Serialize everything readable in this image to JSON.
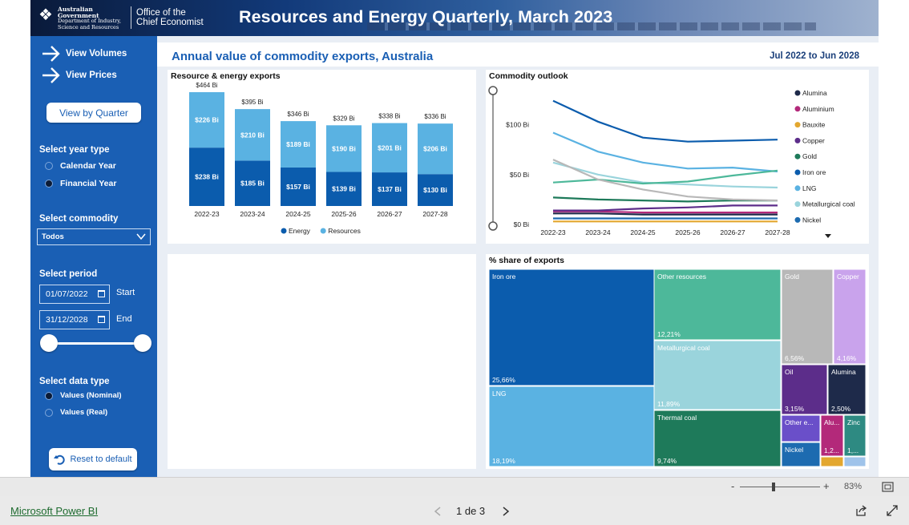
{
  "header": {
    "gov_line1": "Australian Government",
    "gov_line2": "Department of Industry,",
    "gov_line3": "Science and Resources",
    "office_line1": "Office of the",
    "office_line2": "Chief Economist",
    "title": "Resources and Energy Quarterly, March 2023"
  },
  "sidebar": {
    "nav": [
      {
        "label": "View Volumes",
        "icon": "arrow-right-icon"
      },
      {
        "label": "View Prices",
        "icon": "arrow-right-icon"
      }
    ],
    "view_by_quarter": "View by Quarter",
    "year_type": {
      "label": "Select year type",
      "options": [
        "Calendar Year",
        "Financial Year"
      ],
      "selected": "Financial Year"
    },
    "commodity": {
      "label": "Select commodity",
      "value": "Todos"
    },
    "period": {
      "label": "Select period",
      "start_value": "01/07/2022",
      "start_label": "Start",
      "end_value": "31/12/2028",
      "end_label": "End",
      "slider_range": [
        0,
        1
      ]
    },
    "data_type": {
      "label": "Select data type",
      "options": [
        "Values (Nominal)",
        "Values (Real)"
      ],
      "selected": "Values (Nominal)"
    },
    "reset_label": "Reset to default"
  },
  "report": {
    "title": "Annual value of commodity exports, Australia",
    "period": "Jul 2022 to Jun 2028"
  },
  "colors": {
    "energy": "#0b5cad",
    "resources": "#5ab2e2",
    "sidebar": "#1a5fb4"
  },
  "chart_data": [
    {
      "type": "bar",
      "title": "Resource & energy exports",
      "categories": [
        "2022-23",
        "2023-24",
        "2024-25",
        "2025-26",
        "2026-27",
        "2027-28"
      ],
      "stacked": true,
      "series": [
        {
          "name": "Energy",
          "color": "#0b5cad",
          "values": [
            238,
            185,
            157,
            139,
            137,
            130
          ],
          "labels": [
            "$238 Bi",
            "$185 Bi",
            "$157 Bi",
            "$139 Bi",
            "$137 Bi",
            "$130 Bi"
          ]
        },
        {
          "name": "Resources",
          "color": "#5ab2e2",
          "values": [
            226,
            210,
            189,
            190,
            201,
            206
          ],
          "labels": [
            "$226 Bi",
            "$210 Bi",
            "$189 Bi",
            "$190 Bi",
            "$201 Bi",
            "$206 Bi"
          ]
        }
      ],
      "totals": [
        "$464 Bi",
        "$395 Bi",
        "$346 Bi",
        "$329 Bi",
        "$338 Bi",
        "$336 Bi"
      ],
      "ylim": [
        0,
        464
      ],
      "legend": "bottom"
    },
    {
      "type": "line",
      "title": "Commodity outlook",
      "x": [
        "2022-23",
        "2023-24",
        "2024-25",
        "2025-26",
        "2026-27",
        "2027-28"
      ],
      "ylim": [
        0,
        135
      ],
      "yticks": [
        "$0 Bi",
        "$50 Bi",
        "$100 Bi"
      ],
      "ytick_values": [
        0,
        50,
        100
      ],
      "legend": "right",
      "series": [
        {
          "name": "Alumina",
          "color": "#1e2a4a",
          "values": [
            11,
            11,
            10,
            10,
            10,
            10
          ]
        },
        {
          "name": "Aluminium",
          "color": "#b3297a",
          "values": [
            13,
            13,
            12,
            12,
            12,
            12
          ]
        },
        {
          "name": "Bauxite",
          "color": "#e3a72f",
          "values": [
            3,
            3,
            3,
            3,
            3,
            3
          ]
        },
        {
          "name": "Copper",
          "color": "#5c2d8a",
          "values": [
            14,
            14,
            16,
            17,
            19,
            19
          ]
        },
        {
          "name": "Gold",
          "color": "#1e7a5a",
          "values": [
            27,
            25,
            24,
            23,
            24,
            24
          ]
        },
        {
          "name": "Iron ore",
          "color": "#0b5cad",
          "values": [
            124,
            103,
            87,
            83,
            84,
            85
          ]
        },
        {
          "name": "LNG",
          "color": "#5ab2e2",
          "values": [
            92,
            73,
            62,
            56,
            57,
            53
          ]
        },
        {
          "name": "Metallurgical coal",
          "color": "#9ad4dc",
          "values": [
            62,
            50,
            42,
            40,
            38,
            37
          ]
        },
        {
          "name": "Nickel",
          "color": "#1d6bb0",
          "values": [
            6,
            6,
            6,
            6,
            6,
            6
          ]
        },
        {
          "name": "Other resources",
          "color": "#4db89a",
          "values": [
            42,
            45,
            41,
            43,
            49,
            54
          ]
        },
        {
          "name": "Thermal coal",
          "color": "#b8b8b8",
          "values": [
            65,
            45,
            35,
            28,
            25,
            24
          ]
        }
      ],
      "legend_visible": [
        "Alumina",
        "Aluminium",
        "Bauxite",
        "Copper",
        "Gold",
        "Iron ore",
        "LNG",
        "Metallurgical coal",
        "Nickel"
      ]
    },
    {
      "type": "treemap",
      "title": "% share of exports",
      "items": [
        {
          "name": "Iron ore",
          "share": 25.66,
          "label": "25,66%",
          "color": "#0b5cad"
        },
        {
          "name": "LNG",
          "share": 18.19,
          "label": "18,19%",
          "color": "#5ab2e2"
        },
        {
          "name": "Other resources",
          "share": 12.21,
          "label": "12,21%",
          "color": "#4db89a"
        },
        {
          "name": "Metallurgical coal",
          "share": 11.89,
          "label": "11,89%",
          "color": "#9ad4dc"
        },
        {
          "name": "Thermal coal",
          "share": 9.74,
          "label": "9,74%",
          "color": "#1e7a5a"
        },
        {
          "name": "Gold",
          "share": 6.56,
          "label": "6,56%",
          "color": "#b8b8b8"
        },
        {
          "name": "Copper",
          "share": 4.16,
          "label": "4,16%",
          "color": "#c9a3ec"
        },
        {
          "name": "Oil",
          "share": 3.15,
          "label": "3,15%",
          "color": "#5c2d8a"
        },
        {
          "name": "Alumina",
          "share": 2.5,
          "label": "2,50%",
          "color": "#1e2a4a"
        },
        {
          "name": "Other e...",
          "share": null,
          "label": "",
          "color": "#6a4fc9"
        },
        {
          "name": "Alu...",
          "share": null,
          "label": "1,2...",
          "color": "#b3297a"
        },
        {
          "name": "Zinc",
          "share": null,
          "label": "1,...",
          "color": "#2e8a82"
        },
        {
          "name": "Nickel",
          "share": null,
          "label": "",
          "color": "#1d6bb0"
        }
      ]
    }
  ],
  "status": {
    "zoom_minus": "-",
    "zoom_plus": "+",
    "zoom_percent": "83%",
    "zoom_level": 0.5
  },
  "footer": {
    "app_link": "Microsoft Power BI",
    "page_indicator": "1 de 3"
  }
}
